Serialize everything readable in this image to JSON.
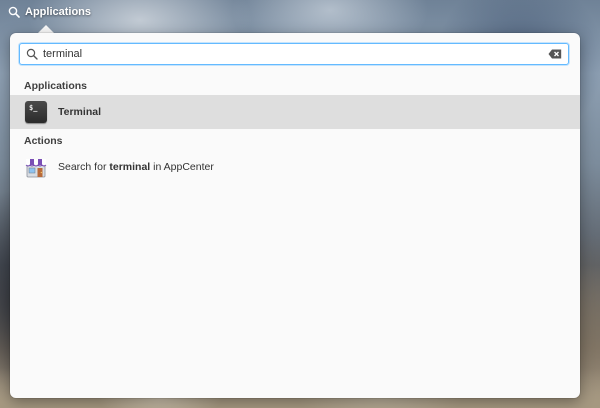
{
  "panel": {
    "applications_label": "Applications",
    "icon": "search-icon"
  },
  "search": {
    "value": "terminal",
    "placeholder": "",
    "icons": {
      "search": "search-icon",
      "clear": "backspace-clear-icon"
    }
  },
  "sections": {
    "applications_header": "Applications",
    "actions_header": "Actions"
  },
  "results": {
    "terminal": {
      "label": "Terminal",
      "icon": "terminal-icon",
      "icon_prompt": "$_"
    },
    "appcenter_action": {
      "prefix": "Search for ",
      "query": "terminal",
      "suffix": " in AppCenter",
      "icon": "appcenter-store-icon"
    }
  },
  "colors": {
    "accent": "#64baff",
    "selected_row": "#dedede",
    "popover_bg": "#fafafa"
  }
}
